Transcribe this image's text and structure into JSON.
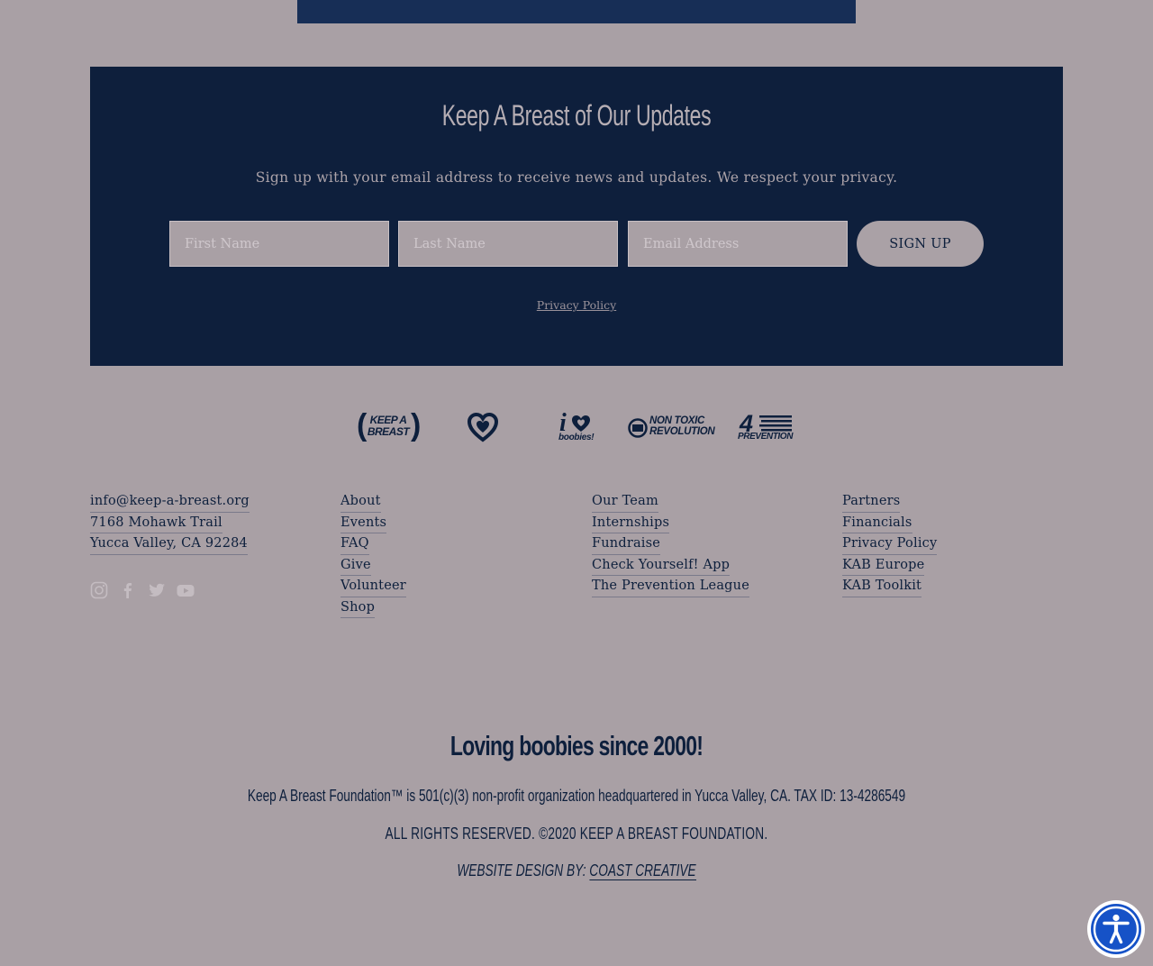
{
  "signup": {
    "title": "Keep A Breast of Our Updates",
    "subtitle": "Sign up with your email address to receive news and updates. We respect your privacy.",
    "first_name_placeholder": "First Name",
    "last_name_placeholder": "Last Name",
    "email_placeholder": "Email Address",
    "button_label": "SIGN UP",
    "privacy_link": "Privacy Policy"
  },
  "logos": {
    "kab_line1": "KEEP A",
    "kab_line2": "BREAST",
    "iheart_word": "boobies!",
    "ntr_line1": "NON TOXIC",
    "ntr_line2": "REVOLUTION",
    "prevention_word": "PREVENTION",
    "prevention_number": "4"
  },
  "contact": {
    "email": "info@keep-a-breast.org",
    "address_line1": "7168 Mohawk Trail",
    "address_line2": "Yucca Valley, CA 92284"
  },
  "social_icons": [
    "instagram-icon",
    "facebook-icon",
    "twitter-icon",
    "youtube-icon"
  ],
  "footer_links": {
    "col2": [
      "About",
      "Events",
      "FAQ",
      "Give",
      "Volunteer",
      "Shop"
    ],
    "col3": [
      "Our Team",
      "Internships",
      "Fundraise",
      "Check Yourself! App",
      "The Prevention League"
    ],
    "col4": [
      "Partners",
      "Financials",
      "Privacy Policy",
      "KAB Europe",
      "KAB Toolkit"
    ]
  },
  "bottom": {
    "tagline": "Loving boobies since 2000!",
    "legal_line": "Keep A Breast Foundation™ is 501(c)(3) non-profit organization headquartered in Yucca Valley, CA. TAX ID: 13-4286549",
    "rights": "ALL RIGHTS RESERVED. ©2020 KEEP A BREAST FOUNDATION.",
    "credit_prefix": "WEBSITE DESIGN BY: ",
    "credit_link": "COAST CREATIVE"
  },
  "colors": {
    "background": "#a9a0a5",
    "signup_panel": "#0e1f3c",
    "top_bar": "#172e56",
    "text": "#0d1f3c",
    "accessibility_button": "#1652c7"
  }
}
